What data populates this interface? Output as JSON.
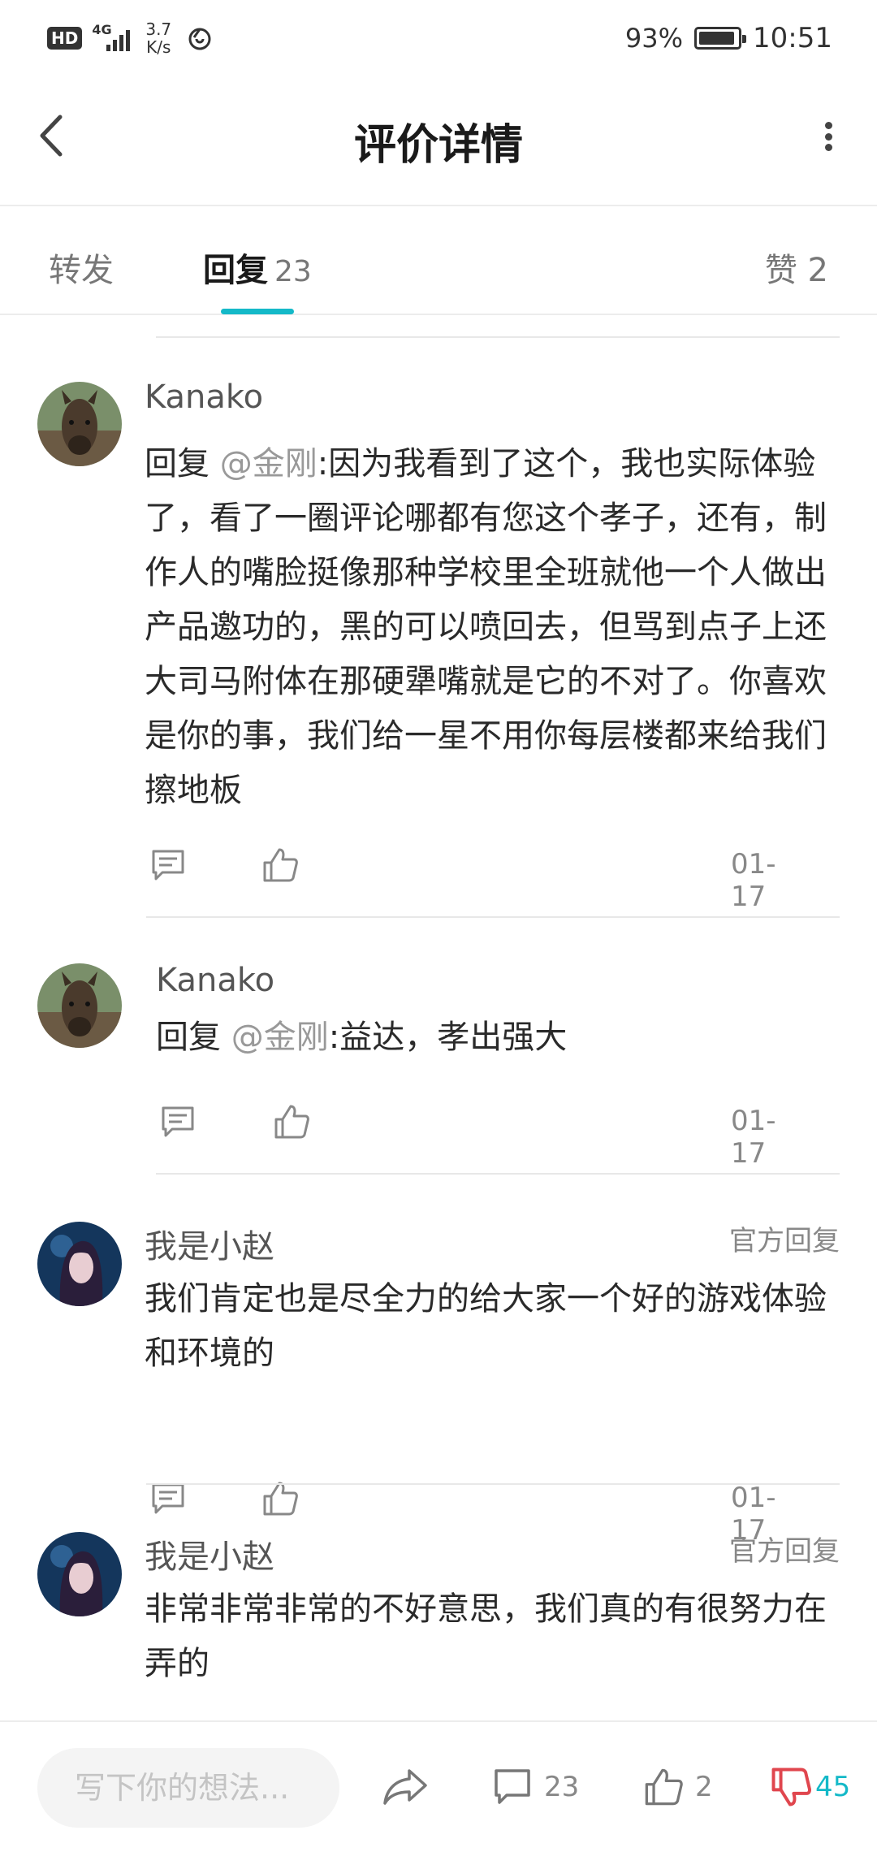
{
  "status_bar": {
    "hd": "HD",
    "network": "4G",
    "speed_value": "3.7",
    "speed_unit": "K/s",
    "battery": "93%",
    "battery_level": 0.93,
    "time": "10:51"
  },
  "header": {
    "title": "评价详情",
    "back_icon": "chevron-left-icon",
    "more_icon": "more-vertical-icon"
  },
  "tabs": {
    "forward": {
      "label": "转发"
    },
    "reply": {
      "label": "回复",
      "count": "23",
      "active": true
    },
    "like": {
      "label": "赞",
      "count": "2"
    }
  },
  "accent_color": "#14b9c8",
  "dislike_color": "#e0464e",
  "comments": [
    {
      "user": "Kanako",
      "reply_prefix": "回复 ",
      "mention": "@金刚",
      "text": ":因为我看到了这个，我也实际体验了，看了一圈评论哪都有您这个孝子，还有，制作人的嘴脸挺像那种学校里全班就他一个人做出产品邀功的，黑的可以喷回去，但骂到点子上还大司马附体在那硬犟嘴就是它的不对了。你喜欢是你的事，我们给一星不用你每层楼都来给我们擦地板",
      "date": "01-17",
      "official": ""
    },
    {
      "user": "Kanako",
      "reply_prefix": "回复 ",
      "mention": "@金刚",
      "text": ":益达，孝出强大",
      "date": "01-17",
      "official": ""
    },
    {
      "user": "我是小赵",
      "reply_prefix": "",
      "mention": "",
      "text": "我们肯定也是尽全力的给大家一个好的游戏体验和环境的",
      "date": "01-17",
      "official": "官方回复"
    },
    {
      "user": "我是小赵",
      "reply_prefix": "",
      "mention": "",
      "text": "非常非常非常的不好意思，我们真的有很努力在弄的",
      "date": "",
      "official": "官方回复"
    }
  ],
  "bottom_bar": {
    "input_placeholder": "写下你的想法...",
    "comment_count": "23",
    "like_count": "2",
    "dislike_count": "45"
  }
}
